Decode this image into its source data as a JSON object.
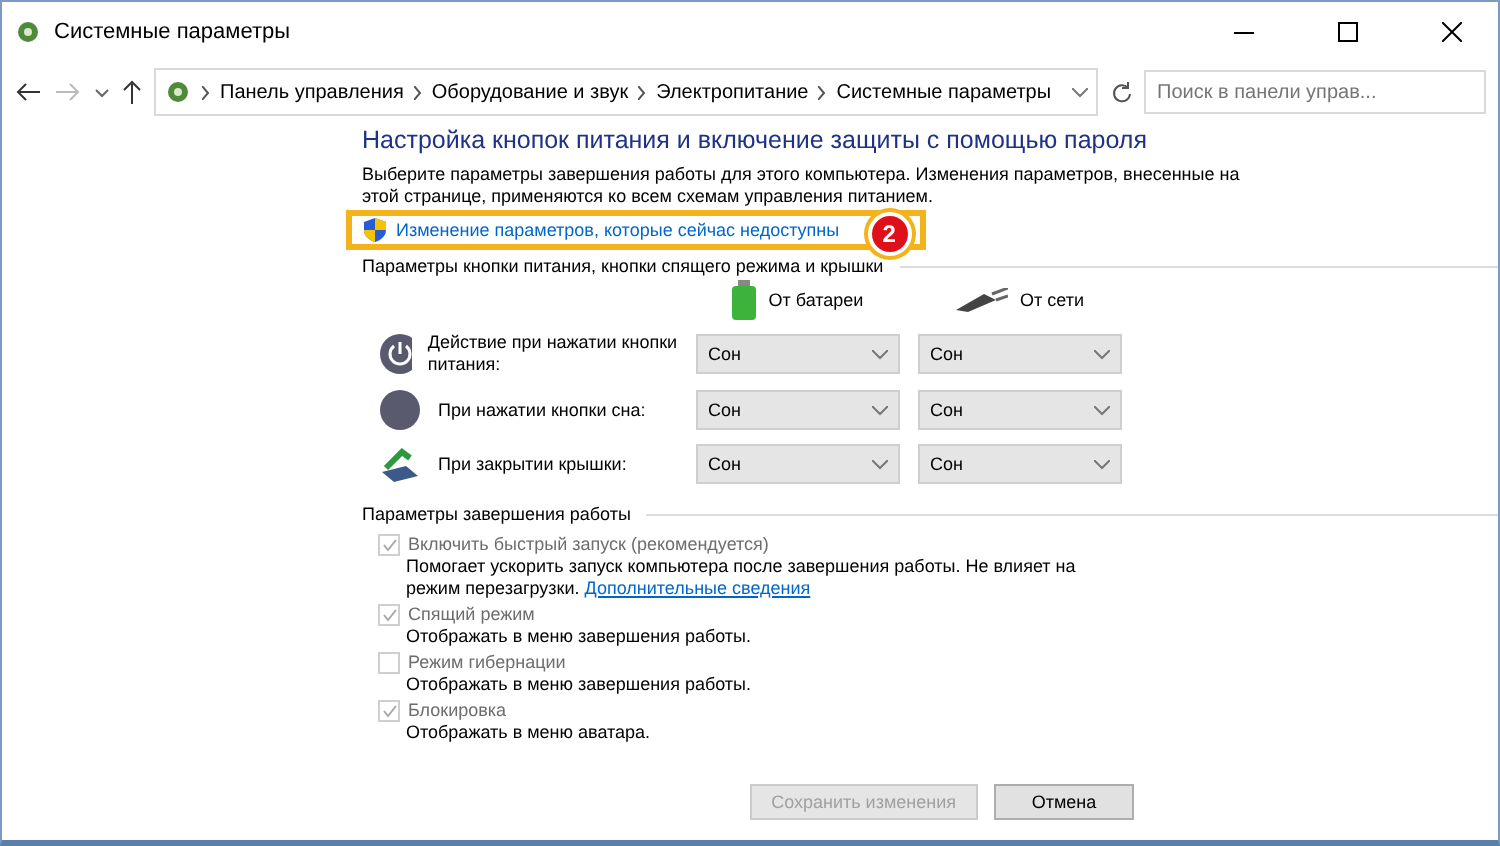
{
  "window": {
    "title": "Системные параметры"
  },
  "address_bar": {
    "crumbs": [
      "Панель управления",
      "Оборудование и звук",
      "Электропитание",
      "Системные параметры"
    ],
    "search_placeholder": "Поиск в панели управ..."
  },
  "heading": "Настройка кнопок питания и включение защиты с помощью пароля",
  "description": [
    "Выберите параметры завершения работы для этого компьютера. Изменения параметров, внесенные на",
    "этой странице, применяются ко всем схемам управления питанием."
  ],
  "admin_link": {
    "text": "Изменение параметров, которые сейчас недоступны",
    "badge": "2"
  },
  "buttons_section": {
    "title": "Параметры кнопки питания, кнопки спящего режима и крышки",
    "columns": [
      {
        "kind": "battery",
        "label": "От батареи"
      },
      {
        "kind": "plug",
        "label": "От сети"
      }
    ],
    "rows": [
      {
        "kind": "power",
        "label": "Действие при нажатии кнопки питания:",
        "values": [
          "Сон",
          "Сон"
        ]
      },
      {
        "kind": "sleep",
        "label": "При нажатии кнопки сна:",
        "values": [
          "Сон",
          "Сон"
        ]
      },
      {
        "kind": "lid",
        "label": "При закрытии крышки:",
        "values": [
          "Сон",
          "Сон"
        ]
      }
    ]
  },
  "shutdown_section": {
    "title": "Параметры завершения работы",
    "options": [
      {
        "label": "Включить быстрый запуск (рекомендуется)",
        "checked": true,
        "description": "Помогает ускорить запуск компьютера после завершения работы. Не влияет на режим перезагрузки.",
        "link": "Дополнительные сведения"
      },
      {
        "label": "Спящий режим",
        "checked": true,
        "description": "Отображать в меню завершения работы."
      },
      {
        "label": "Режим гибернации",
        "checked": false,
        "description": "Отображать в меню завершения работы."
      },
      {
        "label": "Блокировка",
        "checked": true,
        "description": "Отображать в меню аватара."
      }
    ]
  },
  "footer": {
    "save": {
      "label": "Сохранить изменения",
      "disabled": true
    },
    "cancel": {
      "label": "Отмена"
    }
  }
}
